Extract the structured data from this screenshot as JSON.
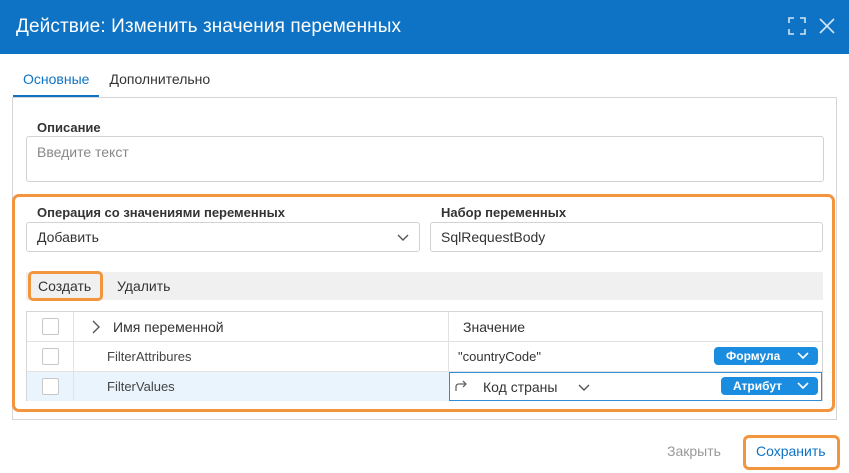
{
  "dialog": {
    "title": "Действие: Изменить значения переменных"
  },
  "tabs": [
    {
      "label": "Основные",
      "active": true
    },
    {
      "label": "Дополнительно",
      "active": false
    }
  ],
  "description": {
    "label": "Описание",
    "placeholder": "Введите текст",
    "value": ""
  },
  "operation": {
    "label": "Операция со значениями переменных",
    "value": "Добавить"
  },
  "variable_set": {
    "label": "Набор переменных",
    "value": "SqlRequestBody"
  },
  "toolbar": {
    "create_label": "Создать",
    "delete_label": "Удалить"
  },
  "grid": {
    "col_name": "Имя переменной",
    "col_value": "Значение",
    "rows": [
      {
        "name": "FilterAttribures",
        "value": "\"countryCode\"",
        "type": "Формула"
      },
      {
        "name": "FilterValues",
        "value": "Код страны",
        "type": "Атрибут"
      }
    ]
  },
  "footer": {
    "close_label": "Закрыть",
    "save_label": "Сохранить"
  },
  "colors": {
    "accent": "#0e73c4",
    "highlight": "#f3953d",
    "pill": "#1a8de0"
  }
}
